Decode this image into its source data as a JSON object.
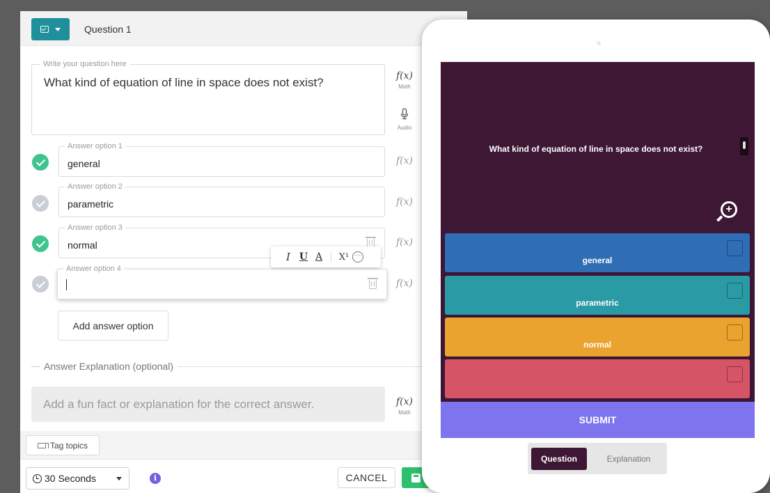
{
  "header": {
    "question_label": "Question 1"
  },
  "question": {
    "legend": "Write your question here",
    "text": "What kind of equation of line in space does not exist?"
  },
  "tools": {
    "math_symbol": "f(x)",
    "math_label": "Math",
    "audio_label": "Audio"
  },
  "options": [
    {
      "legend": "Answer option 1",
      "value": "general",
      "correct": true
    },
    {
      "legend": "Answer option 2",
      "value": "parametric",
      "correct": false
    },
    {
      "legend": "Answer option 3",
      "value": "normal",
      "correct": true
    },
    {
      "legend": "Answer option 4",
      "value": "",
      "correct": false
    }
  ],
  "format_bar": {
    "italic": "I",
    "underline": "U",
    "color": "A",
    "superscript": "X¹",
    "more": "···"
  },
  "add_option_label": "Add answer option",
  "explanation": {
    "heading": "Answer Explanation (optional)",
    "placeholder": "Add a fun fact or explanation for the correct answer."
  },
  "tag_topics_label": "Tag topics",
  "footer": {
    "time_label": "30 Seconds",
    "info_symbol": "i",
    "cancel_label": "CANCEL",
    "save_label": "S"
  },
  "preview": {
    "question_text": "What kind of equation of line in space does not exist?",
    "zoom_symbol": "+",
    "answers": [
      {
        "label": "general",
        "color": "#2f6db5"
      },
      {
        "label": "parametric",
        "color": "#2a9aa5"
      },
      {
        "label": "normal",
        "color": "#eaa32e"
      },
      {
        "label": "",
        "color": "#d55466"
      }
    ],
    "submit_label": "SUBMIT",
    "tab_question": "Question",
    "tab_explanation": "Explanation"
  },
  "colors": {
    "accent": "#1f8f9b",
    "correct": "#3fc38f",
    "preview_bg": "#3d1734",
    "submit": "#7d74ee"
  }
}
